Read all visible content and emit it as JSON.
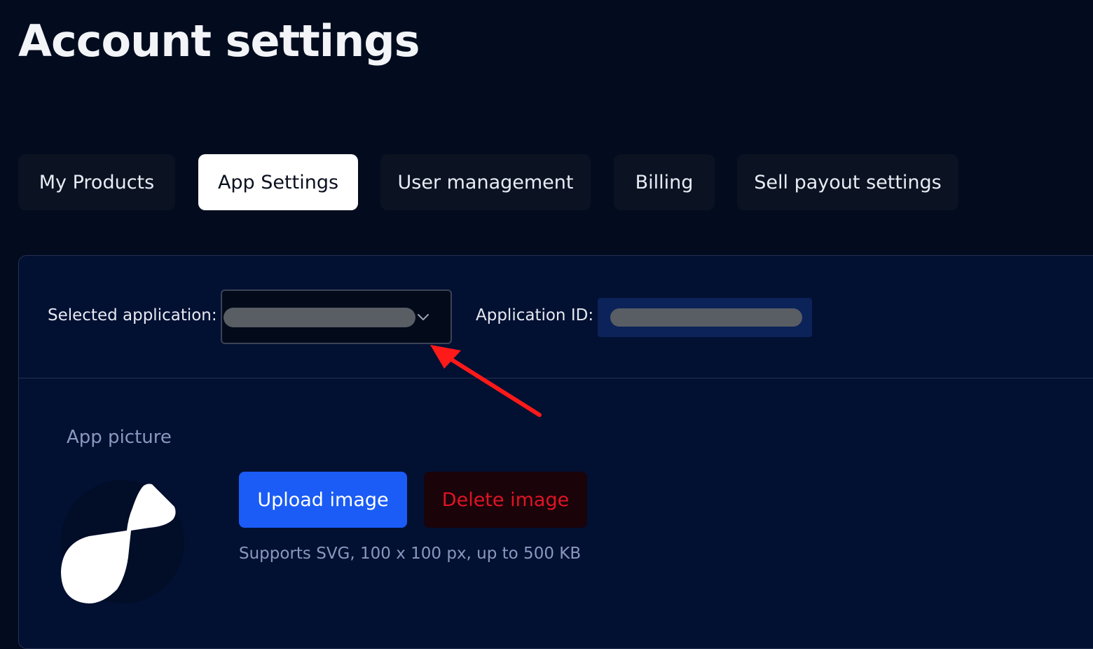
{
  "page": {
    "title": "Account settings"
  },
  "tabs": [
    {
      "label": "My Products",
      "active": false
    },
    {
      "label": "App Settings",
      "active": true
    },
    {
      "label": "User management",
      "active": false
    },
    {
      "label": "Billing",
      "active": false
    },
    {
      "label": "Sell payout settings",
      "active": false
    }
  ],
  "app_selector": {
    "label": "Selected application:",
    "value_redacted": true,
    "icon": "chevron-down-icon"
  },
  "app_id": {
    "label": "Application ID:",
    "value_redacted": true
  },
  "app_picture": {
    "label": "App picture",
    "upload_label": "Upload image",
    "delete_label": "Delete image",
    "hint": "Supports SVG, 100 x 100 px, up to 500 KB"
  },
  "annotation": {
    "type": "red-arrow",
    "points_to": "app-selector"
  },
  "colors": {
    "background": "#020c1e",
    "card": "#021032",
    "accent": "#1a5cf5",
    "danger": "#e01424",
    "annotation": "#ff1a1a"
  }
}
